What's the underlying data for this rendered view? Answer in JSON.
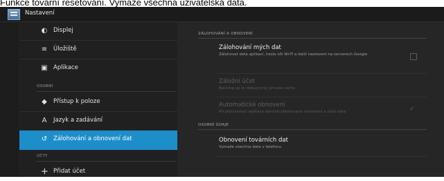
{
  "caption": "Funkce tovární resetování. Vymaže všechna uživatelská data.",
  "actionbar": {
    "title": "Nastavení",
    "icon": "settings-app-icon"
  },
  "sidebar": {
    "items": [
      {
        "label": "Displej",
        "icon": "brightness-icon",
        "glyph": "◐"
      },
      {
        "label": "Úložiště",
        "icon": "storage-icon",
        "glyph": "≡"
      },
      {
        "label": "Aplikace",
        "icon": "apps-icon",
        "glyph": "▣"
      },
      {
        "label": "Přístup k poloze",
        "icon": "location-icon",
        "glyph": "◆"
      },
      {
        "label": "Jazyk a zadávání",
        "icon": "keyboard-icon",
        "glyph": "A"
      },
      {
        "label": "Zálohování a obnovení dat",
        "icon": "backup-icon",
        "glyph": "↺"
      },
      {
        "label": "Přidat účet",
        "icon": "plus-icon",
        "glyph": "+"
      }
    ],
    "headers": {
      "personal": "OSOBNÍ",
      "accounts": "ÚČTY"
    }
  },
  "content": {
    "section_backup": "ZÁLOHOVÁNÍ A OBNOVENÍ",
    "backup": {
      "title": "Zálohování mých dat",
      "summary": "Zálohovat data aplikací, hesla sítí Wi-Fi a další nastavení na serverech Google",
      "checked": false
    },
    "backup_account": {
      "title": "Záložní účet",
      "summary": "Backing up to debug-only private cache"
    },
    "auto_restore": {
      "title": "Automatické obnovení",
      "summary": "Při přeinstalaci aplikace obnovit zálohovaná nastavení a další data",
      "checked": true
    },
    "section_personal": "OSOBNÍ ÚDAJE",
    "factory_reset": {
      "title": "Obnovení továrních dat",
      "summary": "Vymaže všechna data v telefonu"
    }
  },
  "colors": {
    "accent": "#1d8ec9",
    "background": "#1d1d1d"
  }
}
